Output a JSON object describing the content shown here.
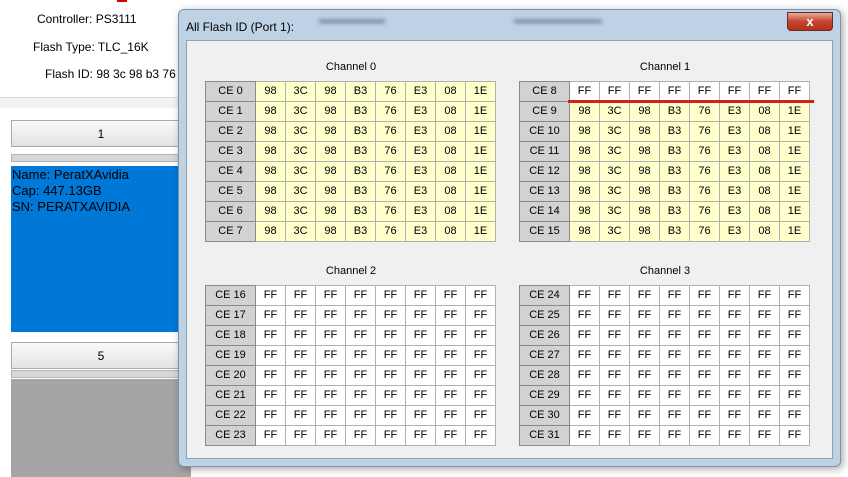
{
  "background": {
    "controller": "Controller: PS3111",
    "flash_type": "Flash Type: TLC_16K",
    "flash_id": "Flash ID: 98 3c 98 b3 76",
    "columns": [
      "1",
      "5"
    ],
    "drive": {
      "name": "Name: PeratXAvidia",
      "cap": "Cap: 447.13GB",
      "sn": "SN: PERATXAVIDIA"
    }
  },
  "dialog": {
    "title": "All Flash ID (Port 1):",
    "close_label": "x",
    "channels": [
      {
        "label": "Channel 0",
        "rows": [
          {
            "ce": "CE 0",
            "values": [
              "98",
              "3C",
              "98",
              "B3",
              "76",
              "E3",
              "08",
              "1E"
            ]
          },
          {
            "ce": "CE 1",
            "values": [
              "98",
              "3C",
              "98",
              "B3",
              "76",
              "E3",
              "08",
              "1E"
            ]
          },
          {
            "ce": "CE 2",
            "values": [
              "98",
              "3C",
              "98",
              "B3",
              "76",
              "E3",
              "08",
              "1E"
            ]
          },
          {
            "ce": "CE 3",
            "values": [
              "98",
              "3C",
              "98",
              "B3",
              "76",
              "E3",
              "08",
              "1E"
            ]
          },
          {
            "ce": "CE 4",
            "values": [
              "98",
              "3C",
              "98",
              "B3",
              "76",
              "E3",
              "08",
              "1E"
            ]
          },
          {
            "ce": "CE 5",
            "values": [
              "98",
              "3C",
              "98",
              "B3",
              "76",
              "E3",
              "08",
              "1E"
            ]
          },
          {
            "ce": "CE 6",
            "values": [
              "98",
              "3C",
              "98",
              "B3",
              "76",
              "E3",
              "08",
              "1E"
            ]
          },
          {
            "ce": "CE 7",
            "values": [
              "98",
              "3C",
              "98",
              "B3",
              "76",
              "E3",
              "08",
              "1E"
            ]
          }
        ]
      },
      {
        "label": "Channel 1",
        "rows": [
          {
            "ce": "CE 8",
            "values": [
              "FF",
              "FF",
              "FF",
              "FF",
              "FF",
              "FF",
              "FF",
              "FF"
            ]
          },
          {
            "ce": "CE 9",
            "values": [
              "98",
              "3C",
              "98",
              "B3",
              "76",
              "E3",
              "08",
              "1E"
            ]
          },
          {
            "ce": "CE 10",
            "values": [
              "98",
              "3C",
              "98",
              "B3",
              "76",
              "E3",
              "08",
              "1E"
            ]
          },
          {
            "ce": "CE 11",
            "values": [
              "98",
              "3C",
              "98",
              "B3",
              "76",
              "E3",
              "08",
              "1E"
            ]
          },
          {
            "ce": "CE 12",
            "values": [
              "98",
              "3C",
              "98",
              "B3",
              "76",
              "E3",
              "08",
              "1E"
            ]
          },
          {
            "ce": "CE 13",
            "values": [
              "98",
              "3C",
              "98",
              "B3",
              "76",
              "E3",
              "08",
              "1E"
            ]
          },
          {
            "ce": "CE 14",
            "values": [
              "98",
              "3C",
              "98",
              "B3",
              "76",
              "E3",
              "08",
              "1E"
            ]
          },
          {
            "ce": "CE 15",
            "values": [
              "98",
              "3C",
              "98",
              "B3",
              "76",
              "E3",
              "08",
              "1E"
            ]
          }
        ]
      },
      {
        "label": "Channel 2",
        "rows": [
          {
            "ce": "CE 16",
            "values": [
              "FF",
              "FF",
              "FF",
              "FF",
              "FF",
              "FF",
              "FF",
              "FF"
            ]
          },
          {
            "ce": "CE 17",
            "values": [
              "FF",
              "FF",
              "FF",
              "FF",
              "FF",
              "FF",
              "FF",
              "FF"
            ]
          },
          {
            "ce": "CE 18",
            "values": [
              "FF",
              "FF",
              "FF",
              "FF",
              "FF",
              "FF",
              "FF",
              "FF"
            ]
          },
          {
            "ce": "CE 19",
            "values": [
              "FF",
              "FF",
              "FF",
              "FF",
              "FF",
              "FF",
              "FF",
              "FF"
            ]
          },
          {
            "ce": "CE 20",
            "values": [
              "FF",
              "FF",
              "FF",
              "FF",
              "FF",
              "FF",
              "FF",
              "FF"
            ]
          },
          {
            "ce": "CE 21",
            "values": [
              "FF",
              "FF",
              "FF",
              "FF",
              "FF",
              "FF",
              "FF",
              "FF"
            ]
          },
          {
            "ce": "CE 22",
            "values": [
              "FF",
              "FF",
              "FF",
              "FF",
              "FF",
              "FF",
              "FF",
              "FF"
            ]
          },
          {
            "ce": "CE 23",
            "values": [
              "FF",
              "FF",
              "FF",
              "FF",
              "FF",
              "FF",
              "FF",
              "FF"
            ]
          }
        ]
      },
      {
        "label": "Channel 3",
        "rows": [
          {
            "ce": "CE 24",
            "values": [
              "FF",
              "FF",
              "FF",
              "FF",
              "FF",
              "FF",
              "FF",
              "FF"
            ]
          },
          {
            "ce": "CE 25",
            "values": [
              "FF",
              "FF",
              "FF",
              "FF",
              "FF",
              "FF",
              "FF",
              "FF"
            ]
          },
          {
            "ce": "CE 26",
            "values": [
              "FF",
              "FF",
              "FF",
              "FF",
              "FF",
              "FF",
              "FF",
              "FF"
            ]
          },
          {
            "ce": "CE 27",
            "values": [
              "FF",
              "FF",
              "FF",
              "FF",
              "FF",
              "FF",
              "FF",
              "FF"
            ]
          },
          {
            "ce": "CE 28",
            "values": [
              "FF",
              "FF",
              "FF",
              "FF",
              "FF",
              "FF",
              "FF",
              "FF"
            ]
          },
          {
            "ce": "CE 29",
            "values": [
              "FF",
              "FF",
              "FF",
              "FF",
              "FF",
              "FF",
              "FF",
              "FF"
            ]
          },
          {
            "ce": "CE 30",
            "values": [
              "FF",
              "FF",
              "FF",
              "FF",
              "FF",
              "FF",
              "FF",
              "FF"
            ]
          },
          {
            "ce": "CE 31",
            "values": [
              "FF",
              "FF",
              "FF",
              "FF",
              "FF",
              "FF",
              "FF",
              "FF"
            ]
          }
        ]
      }
    ]
  },
  "colors": {
    "highlight_cell": "#ffffcc",
    "ce_header": "#d2d2d2",
    "selected_drive": "#0078d7",
    "annotation_red": "#d22020"
  }
}
